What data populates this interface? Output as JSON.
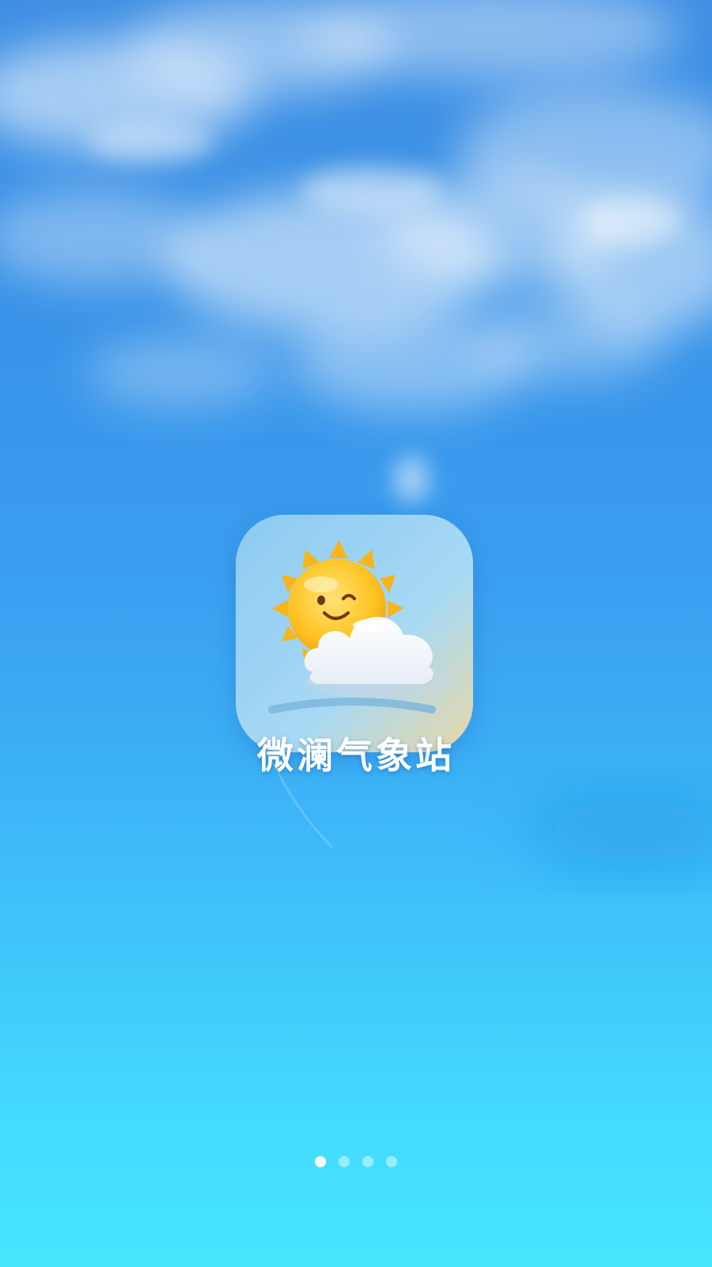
{
  "app": {
    "name": "微澜气象站",
    "icon": "sun-behind-cloud-icon"
  },
  "pager": {
    "count": 4,
    "active_index": 0
  },
  "colors": {
    "sky_top": "#3f8fe4",
    "sky_bottom": "#48e6ff",
    "sun": "#ffc21f",
    "title_text": "#ffffff",
    "dot_active": "#ffffff"
  }
}
